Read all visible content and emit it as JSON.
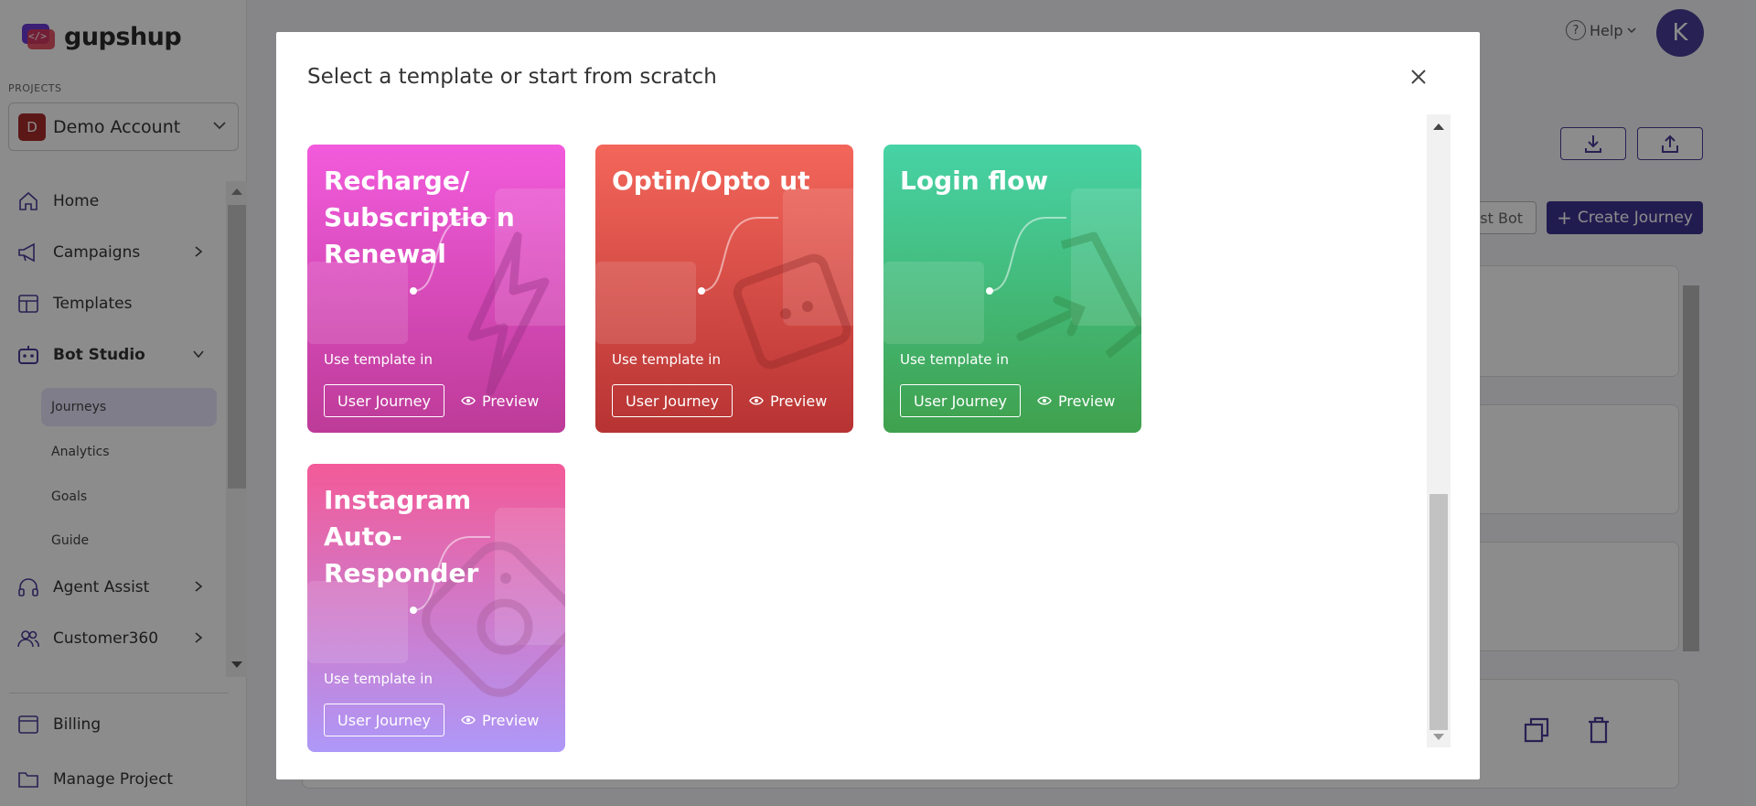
{
  "brand": {
    "name": "gupshup"
  },
  "sidebar": {
    "projects_label": "PROJECTS",
    "project": {
      "initial": "D",
      "name": "Demo Account"
    },
    "nav": [
      {
        "label": "Home",
        "icon": "home-icon"
      },
      {
        "label": "Campaigns",
        "icon": "megaphone-icon"
      },
      {
        "label": "Templates",
        "icon": "templates-icon"
      },
      {
        "label": "Bot Studio",
        "icon": "bot-icon"
      },
      {
        "label": "Agent Assist",
        "icon": "headset-icon"
      },
      {
        "label": "Customer360",
        "icon": "users-icon"
      }
    ],
    "bot_studio_sub": [
      "Journeys",
      "Analytics",
      "Goals",
      "Guide"
    ],
    "bottom": [
      {
        "label": "Billing",
        "icon": "billing-icon"
      },
      {
        "label": "Manage Project",
        "icon": "folder-icon"
      }
    ]
  },
  "header": {
    "help_label": "Help",
    "user_initial": "K",
    "test_bot_label": "est Bot",
    "create_journey_label": "Create Journey"
  },
  "modal": {
    "title": "Select a template or start from scratch",
    "use_template_label": "Use template in",
    "user_journey_label": "User Journey",
    "preview_label": "Preview",
    "templates": [
      {
        "title": "Recharge/ Subscriptio n Renewal",
        "theme": "magenta",
        "colors": [
          "#f25bdc",
          "#bd3b98"
        ]
      },
      {
        "title": "Optin/Opto ut",
        "theme": "red",
        "colors": [
          "#f3665a",
          "#b73333"
        ]
      },
      {
        "title": "Login flow",
        "theme": "green",
        "colors": [
          "#47d3a6",
          "#3fa14d"
        ]
      },
      {
        "title": "Instagram Auto-Responder",
        "theme": "purple",
        "colors": [
          "#f35a98",
          "#ae98f8"
        ]
      }
    ]
  },
  "colors": {
    "accent": "#3d3393",
    "overlay": "rgba(0,0,0,0.45)"
  }
}
